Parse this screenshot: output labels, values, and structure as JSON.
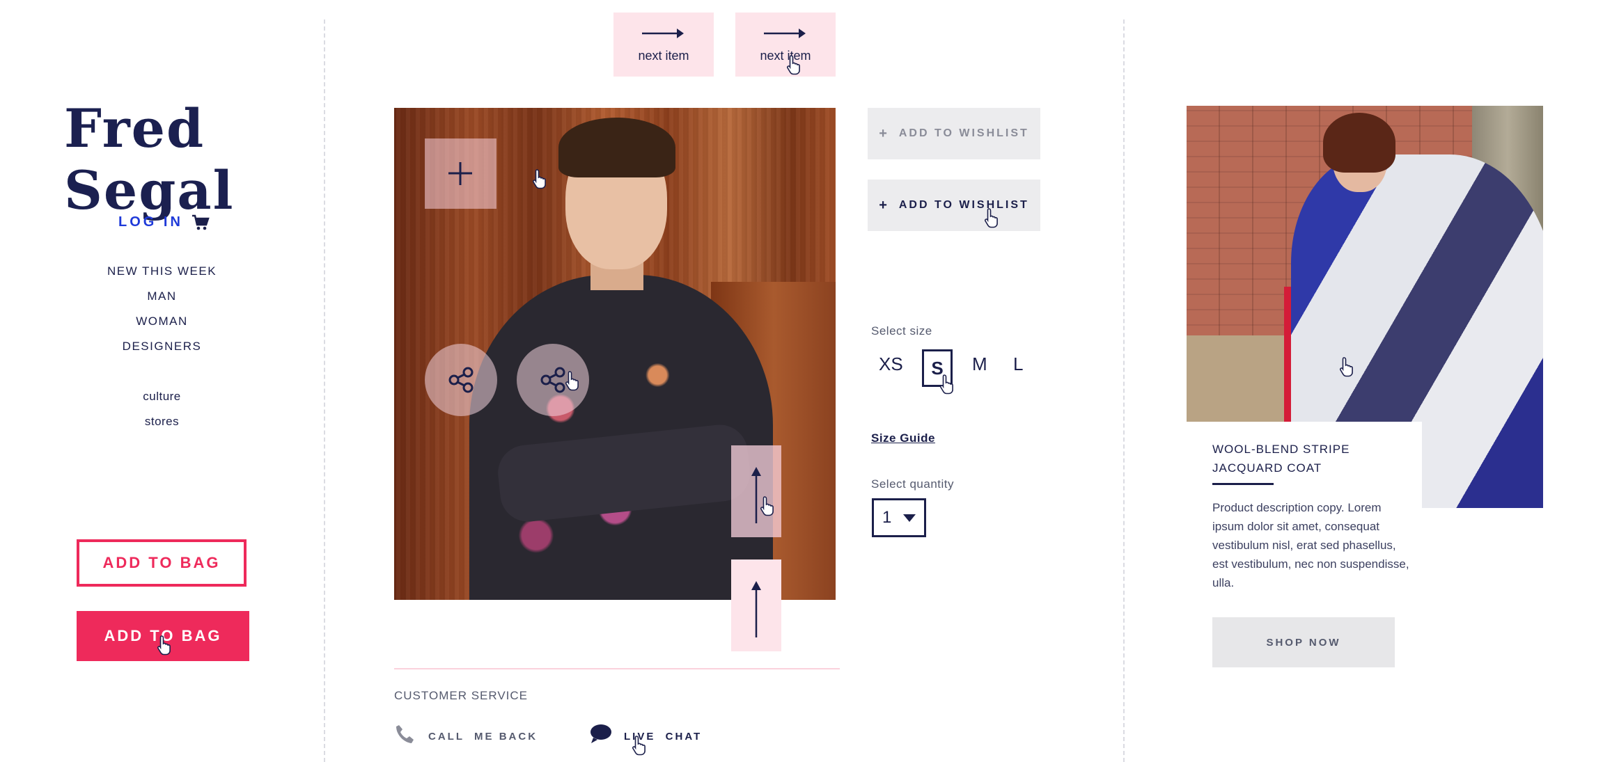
{
  "brand": {
    "logo_text": "Fred Segal"
  },
  "header": {
    "login_label": "LOG IN"
  },
  "nav": {
    "primary": [
      "NEW THIS WEEK",
      "MAN",
      "WOMAN",
      "DESIGNERS"
    ],
    "secondary": [
      "culture",
      "stores"
    ]
  },
  "bag_buttons": {
    "outline_label": "ADD TO BAG",
    "filled_label": "ADD TO BAG"
  },
  "next_items": {
    "label_default": "next item",
    "label_hover": "next item"
  },
  "wishlist": {
    "label_default": "ADD TO WISHLIST",
    "label_hover": "ADD TO WISHLIST"
  },
  "size": {
    "label": "Select size",
    "options": [
      "XS",
      "S",
      "M",
      "L"
    ],
    "selected": "S",
    "guide_label": "Size Guide"
  },
  "quantity": {
    "label": "Select quantity",
    "value": "1"
  },
  "customer_service": {
    "heading": "CUSTOMER SERVICE",
    "call_label": "CALL  ME BACK",
    "chat_label": "LIVE  CHAT"
  },
  "featured": {
    "title": "WOOL-BLEND STRIPE JACQUARD COAT",
    "description": "Product description copy. Lorem ipsum dolor sit amet, consequat vestibulum nisl, erat sed phasellus, est vestibulum, nec non suspendisse, ulla.",
    "shop_label": "SHOP NOW"
  },
  "colors": {
    "accent": "#ee2a5b",
    "navy": "#1b1f4a",
    "link_blue": "#1f3ad9",
    "pink_tint": "#fde4ea",
    "gray_button": "#ececee"
  },
  "icons": [
    "cart-icon",
    "arrow-right-icon",
    "plus-icon",
    "share-icon",
    "arrow-up-icon",
    "hand-cursor-icon",
    "phone-icon",
    "chat-bubble-icon"
  ]
}
